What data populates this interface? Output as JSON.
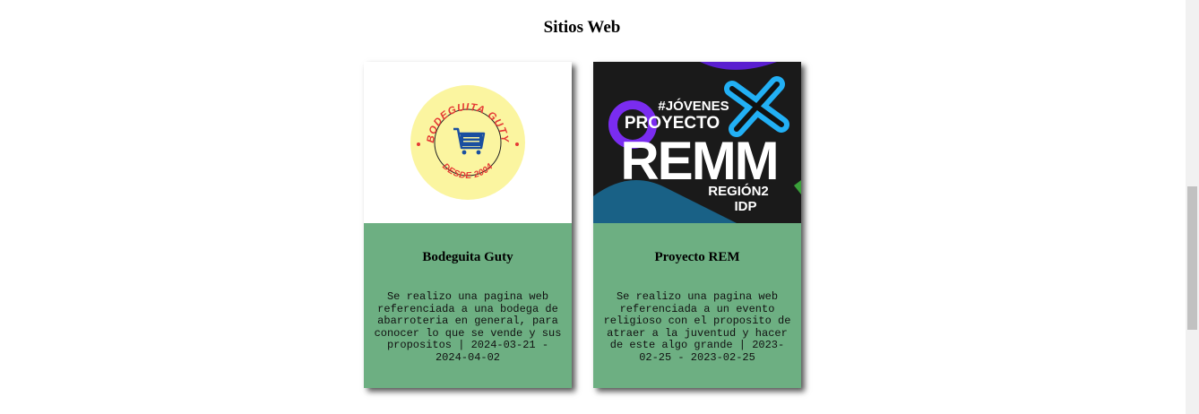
{
  "section": {
    "title": "Sitios Web"
  },
  "cards": [
    {
      "title": "Bodeguita Guty",
      "description": "Se realizo una pagina web referenciada a una bodega de abarroteria en general, para conocer lo que se vende y sus propositos | 2024-03-21 - 2024-04-02",
      "logo": {
        "top_text": "BODEGUITA GUTY",
        "bottom_text": "DESDE 2004",
        "icon": "shopping-cart-icon",
        "bg_color": "#fbf5a0",
        "text_color": "#e53935",
        "icon_color": "#1a4fa0"
      }
    },
    {
      "title": "Proyecto REM",
      "description": "Se realizo una pagina web referenciada a un evento religioso con el proposito de atraer a la juventud y hacer de este algo grande | 2023-02-25 - 2023-02-25",
      "poster": {
        "line1": "#JÓVENES",
        "line2": "PROYECTO",
        "line3": "REMM",
        "line4": "REGIÓN2",
        "line5": "IDP"
      }
    }
  ]
}
